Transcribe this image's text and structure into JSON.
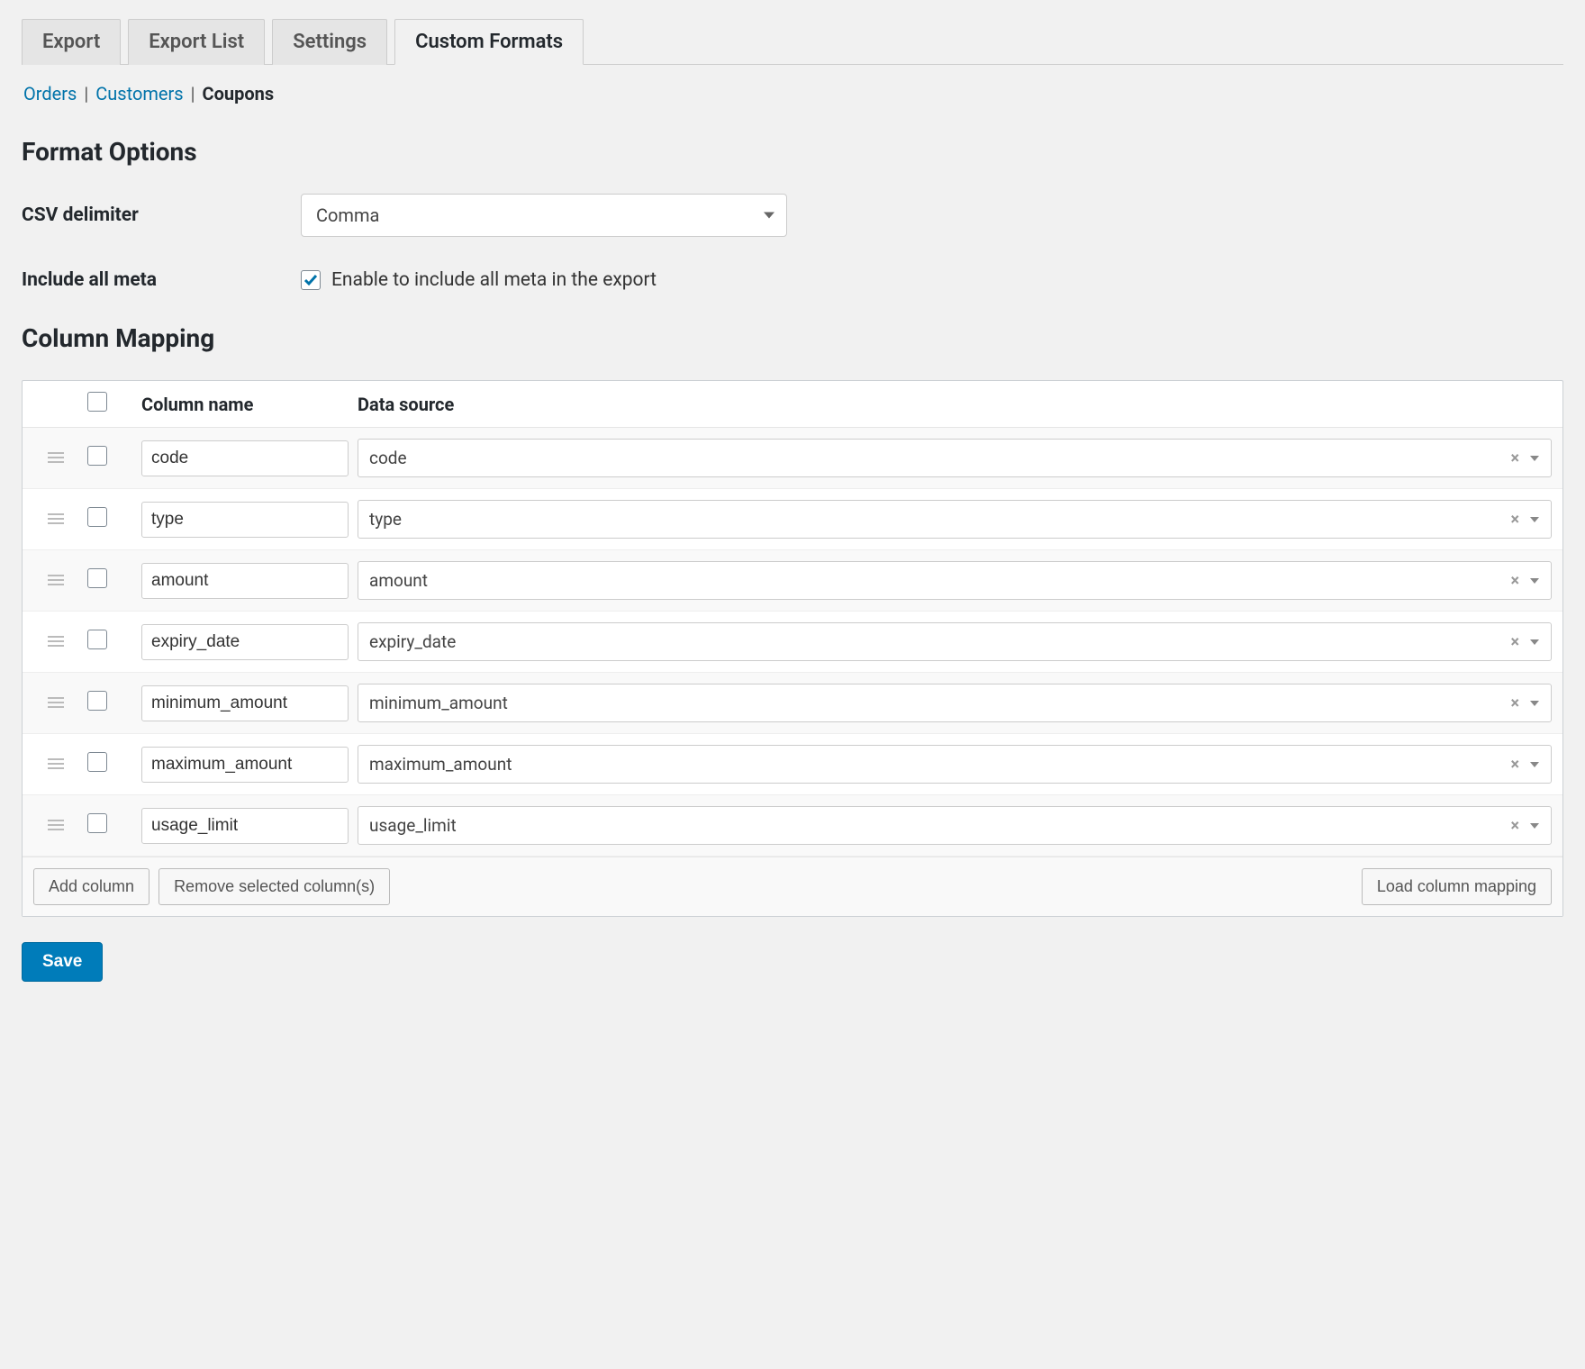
{
  "tabs": [
    {
      "label": "Export"
    },
    {
      "label": "Export List"
    },
    {
      "label": "Settings"
    },
    {
      "label": "Custom Formats"
    }
  ],
  "subnav": {
    "orders": "Orders",
    "customers": "Customers",
    "coupons": "Coupons"
  },
  "sections": {
    "format_options": "Format Options",
    "column_mapping": "Column Mapping"
  },
  "csv_delimiter": {
    "label": "CSV delimiter",
    "value": "Comma"
  },
  "include_meta": {
    "label": "Include all meta",
    "checked": true,
    "option_label": "Enable to include all meta in the export"
  },
  "mapping_header": {
    "col_name": "Column name",
    "data_source": "Data source"
  },
  "rows": [
    {
      "name": "code",
      "source": "code"
    },
    {
      "name": "type",
      "source": "type"
    },
    {
      "name": "amount",
      "source": "amount"
    },
    {
      "name": "expiry_date",
      "source": "expiry_date"
    },
    {
      "name": "minimum_amount",
      "source": "minimum_amount"
    },
    {
      "name": "maximum_amount",
      "source": "maximum_amount"
    },
    {
      "name": "usage_limit",
      "source": "usage_limit"
    }
  ],
  "buttons": {
    "add_column": "Add column",
    "remove_selected": "Remove selected column(s)",
    "load_mapping": "Load column mapping",
    "save": "Save"
  }
}
